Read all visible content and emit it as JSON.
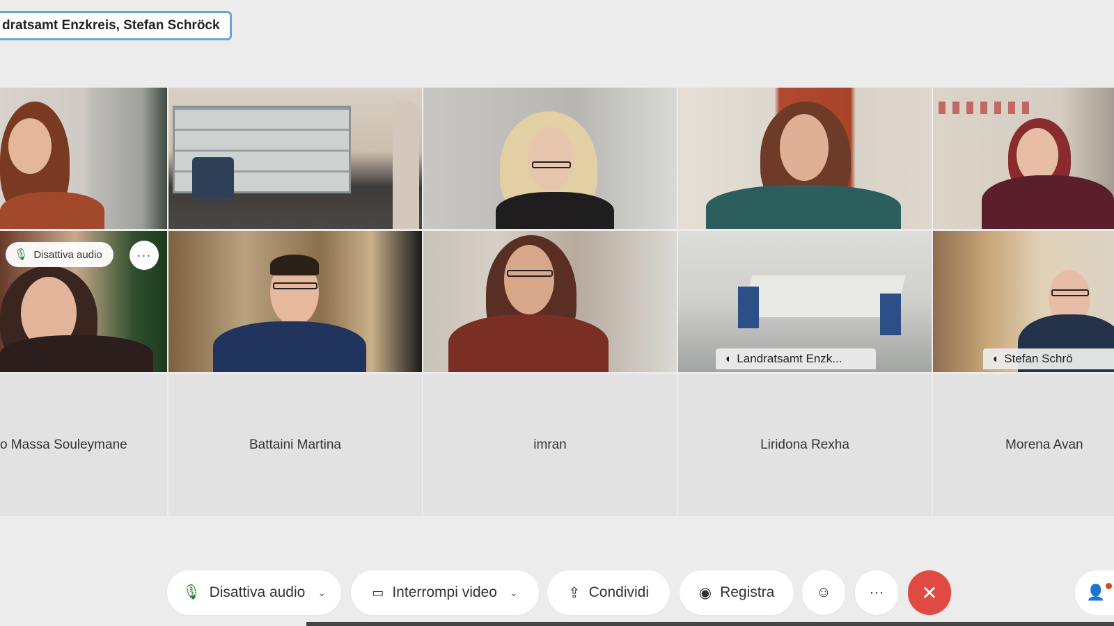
{
  "meeting": {
    "title": "dratsamt Enzkreis, Stefan Schröck"
  },
  "tiles_top": [
    {
      "name_visible": false
    },
    {
      "name_visible": false
    },
    {
      "name_visible": false
    },
    {
      "name_visible": false
    },
    {
      "name_visible": false
    }
  ],
  "hover_controls": {
    "mute_label": "Disattiva audio",
    "more_label": "···"
  },
  "video_labels": {
    "landratsamt": "Landratsamt Enzk...",
    "stefan": "Stefan Schrö"
  },
  "name_tiles": [
    "o Massa Souleymane",
    "Battaini Martina",
    "imran",
    "Liridona Rexha",
    "Morena Avan"
  ],
  "toolbar": {
    "mute_label": "Disattiva audio",
    "video_label": "Interrompi video",
    "share_label": "Condividi",
    "record_label": "Registra",
    "more_label": "···",
    "end_label": "✕"
  },
  "icons": {
    "mic": "mic-icon",
    "camera": "camera-icon",
    "share": "share-icon",
    "record": "record-icon",
    "reaction": "reaction-icon",
    "more": "more-icon",
    "end": "end-call-icon",
    "people": "people-icon",
    "speaker": "speaker-icon"
  },
  "colors": {
    "active_border": "#54a7da",
    "end_call": "#e04a42",
    "title_border": "#6aa7cf"
  }
}
